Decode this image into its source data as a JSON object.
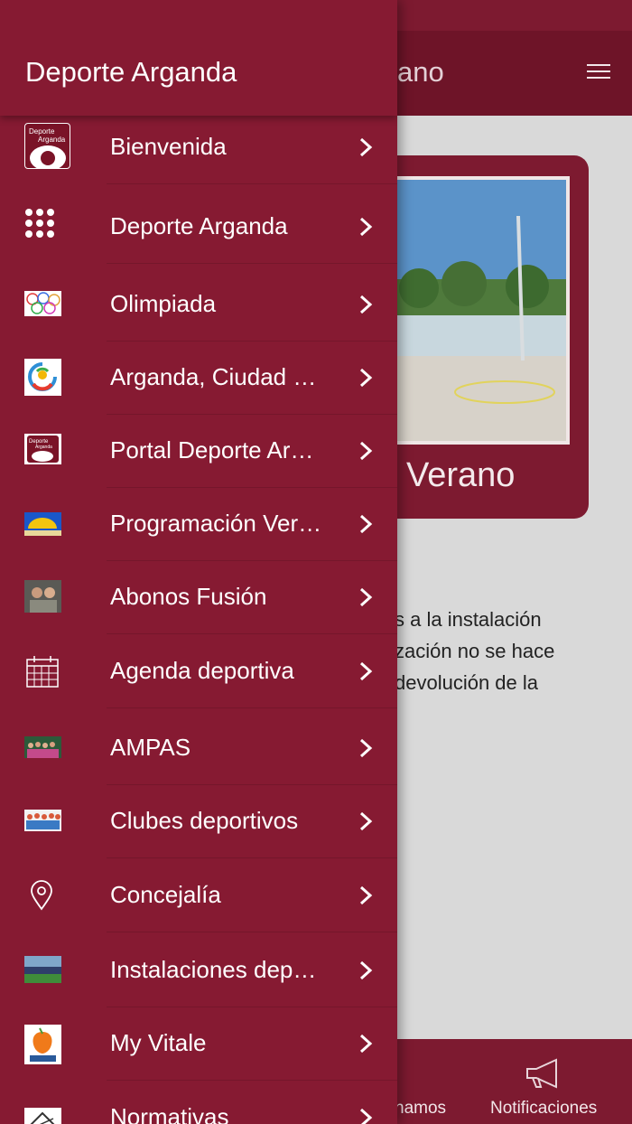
{
  "app": {
    "title_partial": "ano"
  },
  "card": {
    "label": "Verano"
  },
  "body_text": [
    "s a la instalación",
    "zación no se hace",
    "devolución de la"
  ],
  "tabbar": {
    "left_label": "hamos",
    "right_label": "Notificaciones"
  },
  "drawer": {
    "title": "Deporte Arganda",
    "items": [
      {
        "label": "Bienvenida",
        "icon": "deporte-arganda-logo-icon"
      },
      {
        "label": "Deporte Arganda",
        "icon": "dots-grid-icon"
      },
      {
        "label": "Olimpiada",
        "icon": "olympic-rings-icon"
      },
      {
        "label": "Arganda, Ciudad …",
        "icon": "ciudad-logo-icon"
      },
      {
        "label": "Portal Deporte Ar…",
        "icon": "deporte-arganda-logo-icon"
      },
      {
        "label": "Programación Ver…",
        "icon": "umbrella-sky-icon"
      },
      {
        "label": "Abonos Fusión",
        "icon": "people-photo-icon"
      },
      {
        "label": "Agenda deportiva",
        "icon": "calendar-icon"
      },
      {
        "label": "AMPAS",
        "icon": "group-photo-icon"
      },
      {
        "label": "Clubes deportivos",
        "icon": "crowd-photo-icon"
      },
      {
        "label": "Concejalía",
        "icon": "location-pin-icon"
      },
      {
        "label": "Instalaciones dep…",
        "icon": "stadium-photo-icon"
      },
      {
        "label": "My Vitale",
        "icon": "vitale-logo-icon"
      },
      {
        "label": "Normativas",
        "icon": "document-icon"
      }
    ]
  },
  "colors": {
    "primary": "#861a32",
    "header_dark": "#6e1428",
    "content_bg": "#d9d9d9"
  }
}
